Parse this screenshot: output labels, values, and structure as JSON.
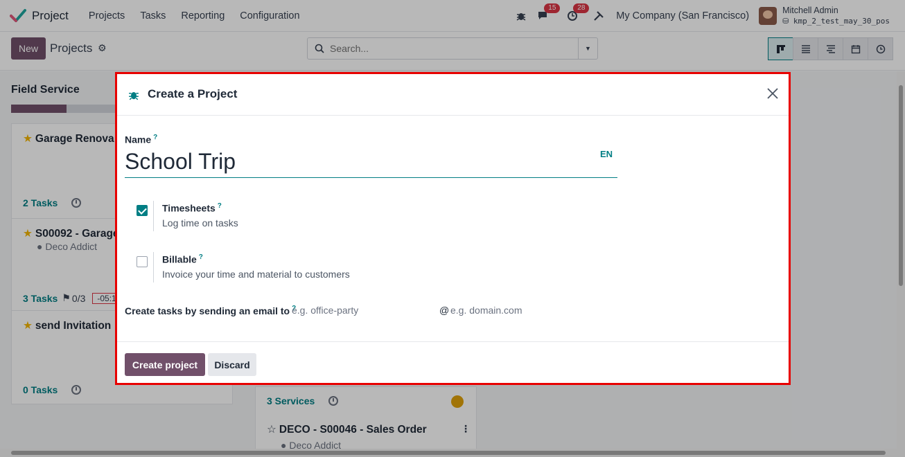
{
  "navbar": {
    "app_name": "Project",
    "menu": [
      "Projects",
      "Tasks",
      "Reporting",
      "Configuration"
    ],
    "messages_count": "15",
    "activities_count": "28",
    "company": "My Company (San Francisco)",
    "user_name": "Mitchell Admin",
    "database": "kmp_2_test_may_30_pos"
  },
  "control_panel": {
    "new_label": "New",
    "breadcrumb": "Projects",
    "search_placeholder": "Search..."
  },
  "kanban": {
    "column_title": "Field Service",
    "progress_fraction": 0.25,
    "cards": [
      {
        "title": "Garage Renova",
        "subtitle": "",
        "footer": "2 Tasks",
        "starred": true
      },
      {
        "title": "S00092 - Garage",
        "subtitle": "Deco Addict",
        "footer": "3 Tasks",
        "extra": "0/3",
        "deadline": "-05:1",
        "starred": true
      },
      {
        "title": "send Invitation",
        "subtitle": "",
        "footer": "0 Tasks",
        "starred": true
      },
      {
        "title": "DECO - S00046 - Sales Order",
        "subtitle": "Deco Addict",
        "footer_top": "3 Services",
        "starred": false
      }
    ]
  },
  "modal": {
    "title": "Create a Project",
    "name_label": "Name",
    "help_mark": "?",
    "name_value": "School Trip",
    "lang": "EN",
    "timesheets_title": "Timesheets",
    "timesheets_desc": "Log time on tasks",
    "timesheets_checked": true,
    "billable_title": "Billable",
    "billable_desc": "Invoice your time and material to customers",
    "billable_checked": false,
    "email_label": "Create tasks by sending an email to",
    "email_alias_placeholder": "e.g. office-party",
    "email_at": "@",
    "email_domain_placeholder": "e.g. domain.com",
    "create_label": "Create project",
    "discard_label": "Discard"
  },
  "colors": {
    "primary": "#71506a",
    "accent": "#017e84",
    "highlight_border": "#e80000",
    "badge": "#dc3545"
  }
}
